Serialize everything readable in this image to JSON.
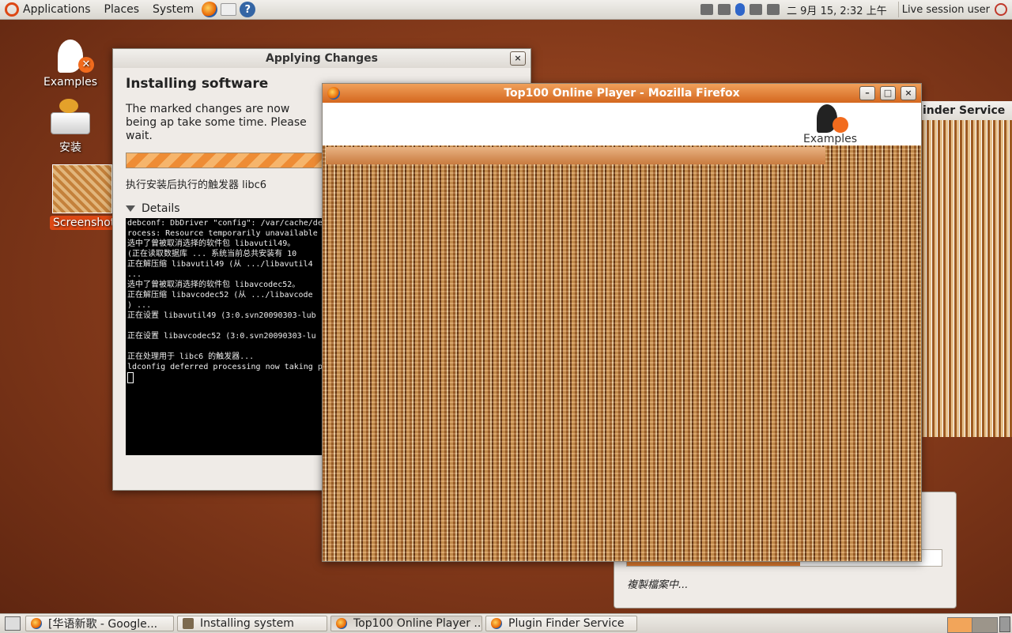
{
  "top_panel": {
    "menus": [
      "Applications",
      "Places",
      "System"
    ],
    "clock": "二  9月 15,  2:32 上午",
    "user": "Live session user"
  },
  "desktop": {
    "icons": [
      {
        "label": "Examples"
      },
      {
        "label": "安装"
      },
      {
        "label": "Screenshot"
      }
    ]
  },
  "applying_window": {
    "title": "Applying Changes",
    "close": "×",
    "heading": "Installing software",
    "description": "The marked changes are now being ap take some time. Please wait.",
    "progress_fraction": 1.0,
    "status": "执行安装后执行的触发器 libc6",
    "details_label": "Details",
    "terminal_lines": [
      "debconf: DbDriver \"config\": /var/cache/de",
      "rocess: Resource temporarily unavailable",
      "选中了曾被取消选择的软件包 libavutil49。",
      "(正在读取数据库 ... 系统当前总共安装有 10",
      "正在解压缩 libavutil49 (从 .../libavutil4",
      "...",
      "选中了曾被取消选择的软件包 libavcodec52。",
      "正在解压缩 libavcodec52 (从 .../libavcode",
      ") ...",
      "正在设置 libavutil49 (3:0.svn20090303-lub",
      "",
      "正在设置 libavcodec52 (3:0.svn20090303-lu",
      "",
      "正在处理用于 libc6 的触发器...",
      "ldconfig deferred processing now taking p"
    ]
  },
  "firefox_window": {
    "title": "Top100 Online Player - Mozilla Firefox",
    "minimize": "–",
    "maximize": "□",
    "close": "×",
    "examples_label": "Examples"
  },
  "plugin_window": {
    "title": "inder Service"
  },
  "copy_dialog": {
    "status": "複製檔案中...",
    "progress_fraction": 0.55
  },
  "taskbar": {
    "tasks": [
      {
        "label": "[华语新歌 - Google...",
        "icon": "firefox-icon"
      },
      {
        "label": "Installing system",
        "icon": "installer-icon"
      },
      {
        "label": "Top100 Online Player ...",
        "icon": "firefox-icon"
      },
      {
        "label": "Plugin Finder Service",
        "icon": "firefox-icon"
      }
    ]
  }
}
